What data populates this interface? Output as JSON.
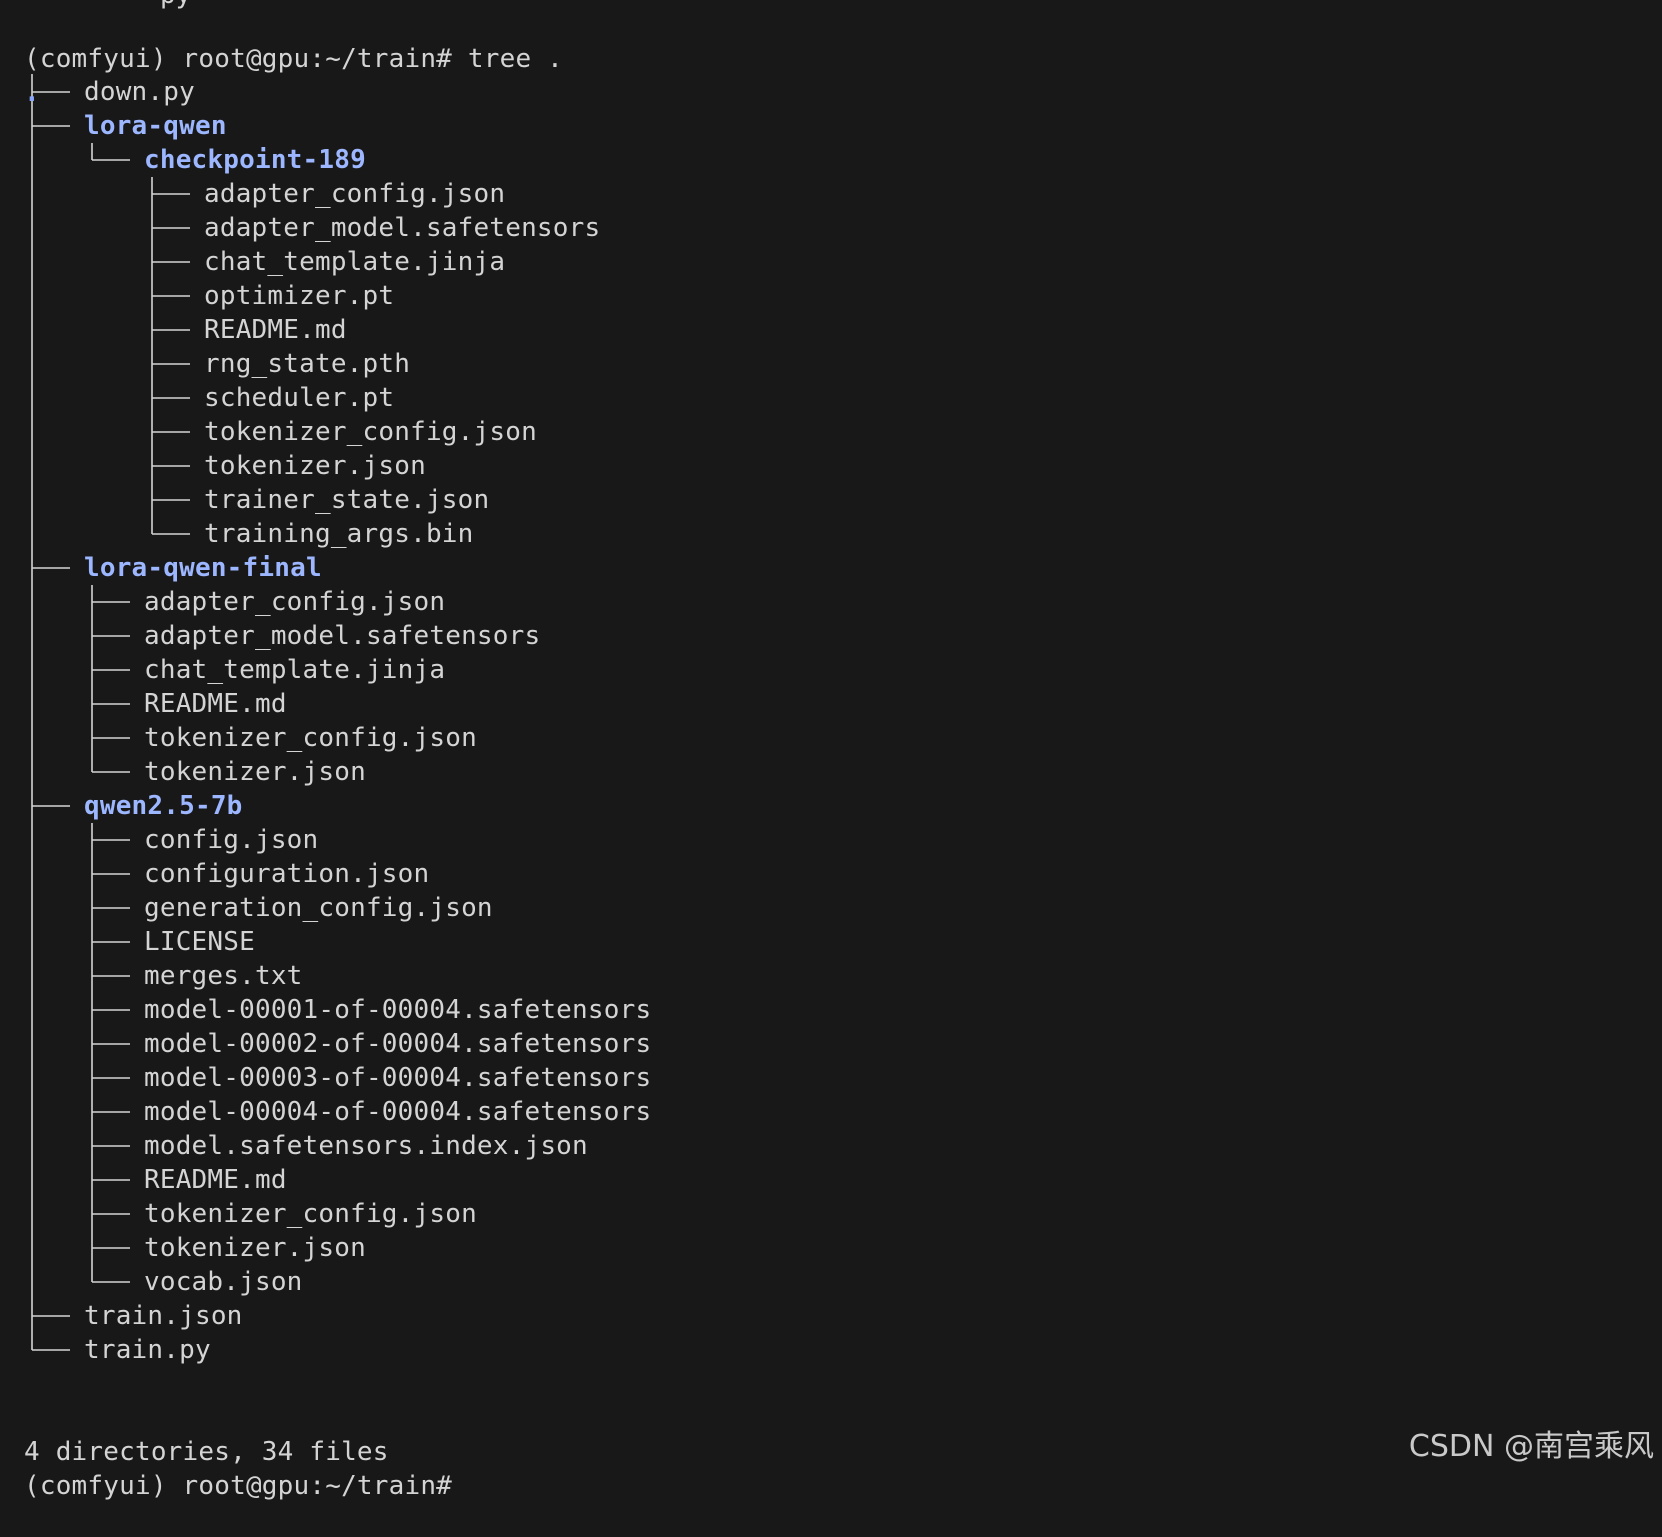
{
  "terminal": {
    "cut_off_previous_line": "py",
    "prompt_line": "(comfyui) root@gpu:~/train# tree .",
    "root_dot": ".",
    "entries": [
      {
        "name": "down.py",
        "type": "file"
      },
      {
        "name": "lora-qwen",
        "type": "dir"
      },
      {
        "name": "checkpoint-189",
        "type": "dir"
      },
      {
        "name": "adapter_config.json",
        "type": "file"
      },
      {
        "name": "adapter_model.safetensors",
        "type": "file"
      },
      {
        "name": "chat_template.jinja",
        "type": "file"
      },
      {
        "name": "optimizer.pt",
        "type": "file"
      },
      {
        "name": "README.md",
        "type": "file"
      },
      {
        "name": "rng_state.pth",
        "type": "file"
      },
      {
        "name": "scheduler.pt",
        "type": "file"
      },
      {
        "name": "tokenizer_config.json",
        "type": "file"
      },
      {
        "name": "tokenizer.json",
        "type": "file"
      },
      {
        "name": "trainer_state.json",
        "type": "file"
      },
      {
        "name": "training_args.bin",
        "type": "file"
      },
      {
        "name": "lora-qwen-final",
        "type": "dir"
      },
      {
        "name": "adapter_config.json",
        "type": "file"
      },
      {
        "name": "adapter_model.safetensors",
        "type": "file"
      },
      {
        "name": "chat_template.jinja",
        "type": "file"
      },
      {
        "name": "README.md",
        "type": "file"
      },
      {
        "name": "tokenizer_config.json",
        "type": "file"
      },
      {
        "name": "tokenizer.json",
        "type": "file"
      },
      {
        "name": "qwen2.5-7b",
        "type": "dir"
      },
      {
        "name": "config.json",
        "type": "file"
      },
      {
        "name": "configuration.json",
        "type": "file"
      },
      {
        "name": "generation_config.json",
        "type": "file"
      },
      {
        "name": "LICENSE",
        "type": "file"
      },
      {
        "name": "merges.txt",
        "type": "file"
      },
      {
        "name": "model-00001-of-00004.safetensors",
        "type": "file"
      },
      {
        "name": "model-00002-of-00004.safetensors",
        "type": "file"
      },
      {
        "name": "model-00003-of-00004.safetensors",
        "type": "file"
      },
      {
        "name": "model-00004-of-00004.safetensors",
        "type": "file"
      },
      {
        "name": "model.safetensors.index.json",
        "type": "file"
      },
      {
        "name": "README.md",
        "type": "file"
      },
      {
        "name": "tokenizer_config.json",
        "type": "file"
      },
      {
        "name": "tokenizer.json",
        "type": "file"
      },
      {
        "name": "vocab.json",
        "type": "file"
      },
      {
        "name": "train.json",
        "type": "file"
      },
      {
        "name": "train.py",
        "type": "file"
      }
    ],
    "summary": "4 directories, 34 files",
    "final_prompt": "(comfyui) root@gpu:~/train#"
  },
  "colors": {
    "background": "#181818",
    "text": "#d4d4d4",
    "directory": "#9cb6ff"
  },
  "watermark": "CSDN @南宫乘风"
}
